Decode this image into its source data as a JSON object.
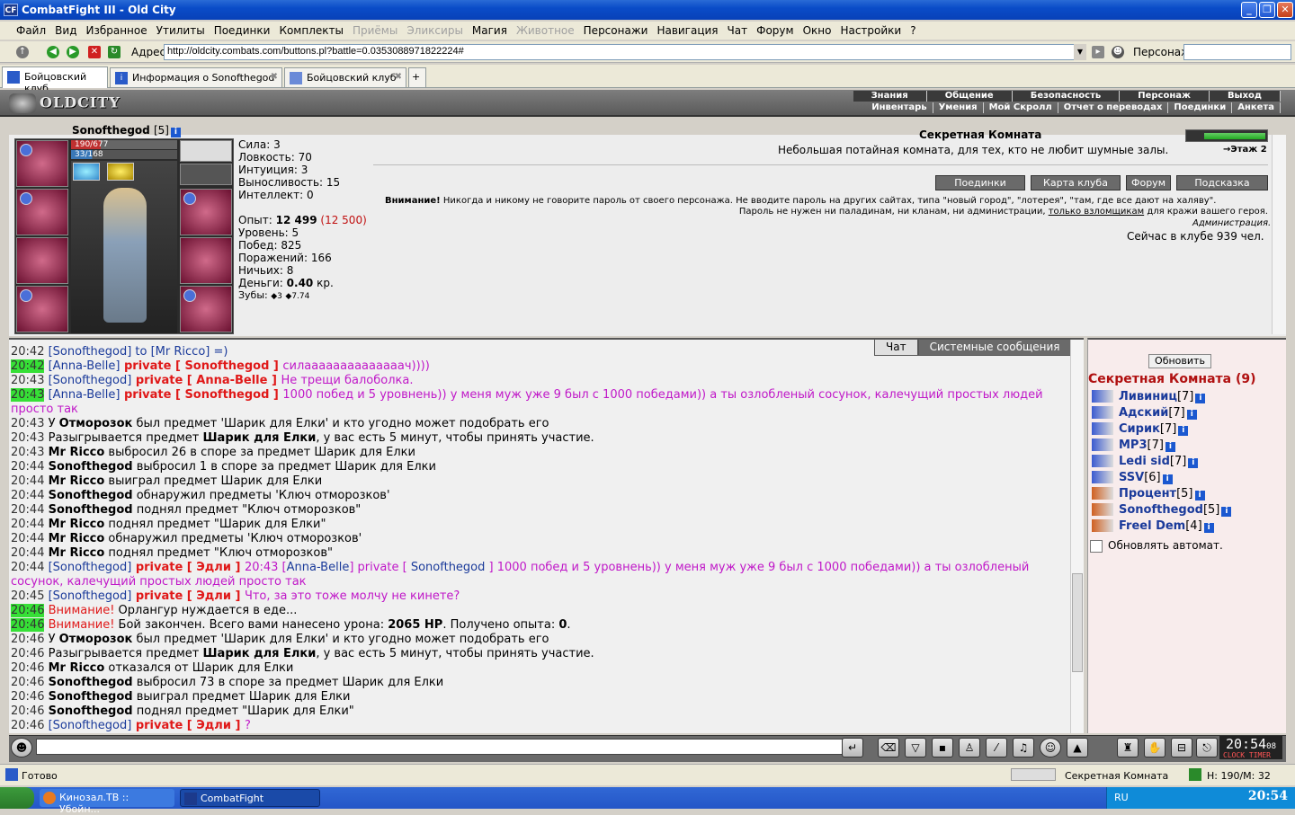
{
  "window": {
    "title": "CombatFight III - Old City",
    "app_icon": "CF"
  },
  "menu": [
    "Файл",
    "Вид",
    "Избранное",
    "Утилиты",
    "Поединки",
    "Комплекты",
    "Приёмы",
    "Эликсиры",
    "Магия",
    "Животное",
    "Персонажи",
    "Навигация",
    "Чат",
    "Форум",
    "Окно",
    "Настройки",
    "?"
  ],
  "menu_disabled": [
    false,
    false,
    false,
    false,
    false,
    false,
    true,
    true,
    false,
    true,
    false,
    false,
    false,
    false,
    false,
    false,
    false
  ],
  "address": {
    "label": "Адрес:",
    "value": "http://oldcity.combats.com/buttons.pl?battle=0.0353088971822224#"
  },
  "persona": {
    "label": "Персонаж:",
    "value": ""
  },
  "tabs": [
    {
      "label": "Бойцовский клуб",
      "active": true
    },
    {
      "label": "Информация о Sonofthegod",
      "active": false
    },
    {
      "label": "Бойцовский клуб",
      "active": false
    }
  ],
  "game_nav": {
    "logo": "OLDCITY",
    "top": [
      "Знания",
      "Общение",
      "Безопасность",
      "Персонаж",
      "Выход"
    ],
    "bottom": [
      "Инвентарь",
      "Умения",
      "Мой Скролл",
      "Отчет о переводах",
      "Поединки",
      "Анкета"
    ]
  },
  "character": {
    "name": "Sonofthegod",
    "level": "[5]",
    "hp": "190/677",
    "mana": "33/168",
    "hp_fraction": 0.28,
    "mana_fraction": 0.2,
    "stats": [
      {
        "label": "Сила:",
        "value": "3"
      },
      {
        "label": "Ловкость:",
        "value": "70"
      },
      {
        "label": "Интуиция:",
        "value": "3"
      },
      {
        "label": "Выносливость:",
        "value": "15"
      },
      {
        "label": "Интеллект:",
        "value": "0"
      }
    ],
    "exp_label": "Опыт:",
    "exp": "12 499",
    "exp_next": "(12 500)",
    "level_label": "Уровень:",
    "level_value": "5",
    "wins_label": "Побед:",
    "wins": "825",
    "losses_label": "Поражений:",
    "losses": "166",
    "draws_label": "Ничьих:",
    "draws": "8",
    "money_label": "Деньги:",
    "money": "0.40",
    "money_unit": "кр.",
    "teeth_label": "Зубы:",
    "teeth": "3",
    "teeth2": "7.74"
  },
  "room": {
    "title": "Секретная Комната",
    "description": "Небольшая потайная комната, для тех, кто не любит шумные залы.",
    "floor": "Этаж 2",
    "buttons": [
      "Поединки",
      "Карта клуба",
      "Форум",
      "Подсказка"
    ],
    "warning_bold": "Внимание!",
    "warning_text": "Никогда и никому не говорите пароль от своего персонажа. Не вводите пароль на других сайтах, типа \"новый город\", \"лотерея\", \"там, где все дают на халяву\".",
    "warning_line2a": "Пароль не нужен ни паладинам, ни кланам, ни администрации,",
    "warning_link": "только взломщикам",
    "warning_line2b": "для кражи вашего героя.",
    "admin_sign": "Администрация.",
    "online_text": "Сейчас в клубе 939 чел."
  },
  "chat": {
    "tabs": [
      "Чат",
      "Системные сообщения"
    ],
    "lines": [
      {
        "ts": "20:42",
        "hl": false,
        "parts": [
          {
            "t": "[Sonofthegod]",
            "c": "nick"
          },
          {
            "t": " to [Mr Ricco] =)",
            "c": "nick"
          }
        ]
      },
      {
        "ts": "20:42",
        "hl": true,
        "parts": [
          {
            "t": "[Anna-Belle]",
            "c": "nick"
          },
          {
            "t": " private [ Sonofthegod ] ",
            "c": "priv"
          },
          {
            "t": "силаааааааааааааач))))",
            "c": "pm"
          }
        ]
      },
      {
        "ts": "20:43",
        "hl": false,
        "parts": [
          {
            "t": "[Sonofthegod]",
            "c": "nick"
          },
          {
            "t": " private [ Anna-Belle ] ",
            "c": "priv"
          },
          {
            "t": "Не трещи балоболка.",
            "c": "pm"
          }
        ]
      },
      {
        "ts": "20:43",
        "hl": true,
        "parts": [
          {
            "t": "[Anna-Belle]",
            "c": "nick"
          },
          {
            "t": " private [ Sonofthegod ] ",
            "c": "priv"
          },
          {
            "t": "1000 побед и 5 уровнень)) у меня муж уже 9 был с 1000 победами)) а ты озлобленый сосунок, калечущий простых людей просто так",
            "c": "pm"
          }
        ]
      },
      {
        "ts": "20:43",
        "hl": false,
        "parts": [
          {
            "t": "У ",
            "c": ""
          },
          {
            "t": "Отморозок",
            "c": "b"
          },
          {
            "t": " был предмет 'Шарик для Елки' и кто угодно может подобрать его",
            "c": ""
          }
        ]
      },
      {
        "ts": "20:43",
        "hl": false,
        "parts": [
          {
            "t": "Разыгрывается предмет ",
            "c": ""
          },
          {
            "t": "Шарик для Елки",
            "c": "b"
          },
          {
            "t": ", у вас есть 5 минут, чтобы принять участие.",
            "c": ""
          }
        ]
      },
      {
        "ts": "20:43",
        "hl": false,
        "parts": [
          {
            "t": "Mr Ricco",
            "c": "b"
          },
          {
            "t": " выбросил 26 в споре за предмет Шарик для Елки",
            "c": ""
          }
        ]
      },
      {
        "ts": "20:44",
        "hl": false,
        "parts": [
          {
            "t": "Sonofthegod",
            "c": "b"
          },
          {
            "t": " выбросил 1 в споре за предмет Шарик для Елки",
            "c": ""
          }
        ]
      },
      {
        "ts": "20:44",
        "hl": false,
        "parts": [
          {
            "t": "Mr Ricco",
            "c": "b"
          },
          {
            "t": " выиграл предмет Шарик для Елки",
            "c": ""
          }
        ]
      },
      {
        "ts": "20:44",
        "hl": false,
        "parts": [
          {
            "t": "Sonofthegod",
            "c": "b"
          },
          {
            "t": " обнаружил предметы 'Ключ отморозков'",
            "c": ""
          }
        ]
      },
      {
        "ts": "20:44",
        "hl": false,
        "parts": [
          {
            "t": "Sonofthegod",
            "c": "b"
          },
          {
            "t": " поднял предмет \"Ключ отморозков\"",
            "c": ""
          }
        ]
      },
      {
        "ts": "20:44",
        "hl": false,
        "parts": [
          {
            "t": "Mr Ricco",
            "c": "b"
          },
          {
            "t": " поднял предмет \"Шарик для Елки\"",
            "c": ""
          }
        ]
      },
      {
        "ts": "20:44",
        "hl": false,
        "parts": [
          {
            "t": "Mr Ricco",
            "c": "b"
          },
          {
            "t": " обнаружил предметы 'Ключ отморозков'",
            "c": ""
          }
        ]
      },
      {
        "ts": "20:44",
        "hl": false,
        "parts": [
          {
            "t": "Mr Ricco",
            "c": "b"
          },
          {
            "t": " поднял предмет \"Ключ отморозков\"",
            "c": ""
          }
        ]
      },
      {
        "ts": "20:44",
        "hl": false,
        "parts": [
          {
            "t": "[Sonofthegod]",
            "c": "nick"
          },
          {
            "t": " private [ Эдли ] ",
            "c": "priv"
          },
          {
            "t": "20:43 [",
            "c": "pm"
          },
          {
            "t": "Anna-Belle",
            "c": "nick"
          },
          {
            "t": "] private [ ",
            "c": "pm"
          },
          {
            "t": "Sonofthegod",
            "c": "nick"
          },
          {
            "t": " ] 1000 побед и 5 уровнень)) у меня муж уже 9 был с 1000 победами)) а ты озлобленый сосунок, калечущий простых людей просто так",
            "c": "pm"
          }
        ]
      },
      {
        "ts": "20:45",
        "hl": false,
        "parts": [
          {
            "t": "[Sonofthegod]",
            "c": "nick"
          },
          {
            "t": " private [ Эдли ] ",
            "c": "priv"
          },
          {
            "t": "Что, за это тоже молчу не кинете?",
            "c": "pm"
          }
        ]
      },
      {
        "ts": "20:46",
        "hl": true,
        "parts": [
          {
            "t": "Внимание!",
            "c": "attn"
          },
          {
            "t": " Орлангур нуждается в еде...",
            "c": ""
          }
        ]
      },
      {
        "ts": "20:46",
        "hl": true,
        "parts": [
          {
            "t": "Внимание!",
            "c": "attn"
          },
          {
            "t": " Бой закончен. Всего вами нанесено урона: ",
            "c": ""
          },
          {
            "t": "2065 HP",
            "c": "b"
          },
          {
            "t": ". Получено опыта: ",
            "c": ""
          },
          {
            "t": "0",
            "c": "b"
          },
          {
            "t": ".",
            "c": ""
          }
        ]
      },
      {
        "ts": "20:46",
        "hl": false,
        "parts": [
          {
            "t": "У ",
            "c": ""
          },
          {
            "t": "Отморозок",
            "c": "b"
          },
          {
            "t": " был предмет 'Шарик для Елки' и кто угодно может подобрать его",
            "c": ""
          }
        ]
      },
      {
        "ts": "20:46",
        "hl": false,
        "parts": [
          {
            "t": "Разыгрывается предмет ",
            "c": ""
          },
          {
            "t": "Шарик для Елки",
            "c": "b"
          },
          {
            "t": ", у вас есть 5 минут, чтобы принять участие.",
            "c": ""
          }
        ]
      },
      {
        "ts": "20:46",
        "hl": false,
        "parts": [
          {
            "t": "Mr Ricco",
            "c": "b"
          },
          {
            "t": " отказался от Шарик для Елки",
            "c": ""
          }
        ]
      },
      {
        "ts": "20:46",
        "hl": false,
        "parts": [
          {
            "t": "Sonofthegod",
            "c": "b"
          },
          {
            "t": " выбросил 73 в споре за предмет Шарик для Елки",
            "c": ""
          }
        ]
      },
      {
        "ts": "20:46",
        "hl": false,
        "parts": [
          {
            "t": "Sonofthegod",
            "c": "b"
          },
          {
            "t": " выиграл предмет Шарик для Елки",
            "c": ""
          }
        ]
      },
      {
        "ts": "20:46",
        "hl": false,
        "parts": [
          {
            "t": "Sonofthegod",
            "c": "b"
          },
          {
            "t": " поднял предмет \"Шарик для Елки\"",
            "c": ""
          }
        ]
      },
      {
        "ts": "20:46",
        "hl": false,
        "parts": [
          {
            "t": "[Sonofthegod]",
            "c": "nick"
          },
          {
            "t": " private [ Эдли ] ",
            "c": "priv"
          },
          {
            "t": "?",
            "c": "pm"
          }
        ]
      }
    ]
  },
  "room_users": {
    "refresh_label": "Обновить",
    "title": "Секретная Комната (9)",
    "users": [
      {
        "name": "Ливиниц",
        "level": "[7]"
      },
      {
        "name": "Адский",
        "level": "[7]"
      },
      {
        "name": "Сирик",
        "level": "[7]"
      },
      {
        "name": "МР3",
        "level": "[7]"
      },
      {
        "name": "Ledi sid",
        "level": "[7]"
      },
      {
        "name": "SSV",
        "level": "[6]"
      },
      {
        "name": "Процент",
        "level": "[5]"
      },
      {
        "name": "Sonofthegod",
        "level": "[5]"
      },
      {
        "name": "Freel Dem",
        "level": "[4]"
      }
    ],
    "auto_refresh_label": "Обновлять автомат."
  },
  "clock": {
    "time": "20:54",
    "seconds": "08",
    "labels": "CLOCK TIMER"
  },
  "statusbar": {
    "text": "Готово",
    "room": "Секретная Комната",
    "hp": "H: 190/M: 32"
  },
  "taskbar": {
    "tasks": [
      "Кинозал.ТВ :: Убойн...",
      "CombatFight"
    ],
    "lang": "RU",
    "time": "20:54"
  }
}
